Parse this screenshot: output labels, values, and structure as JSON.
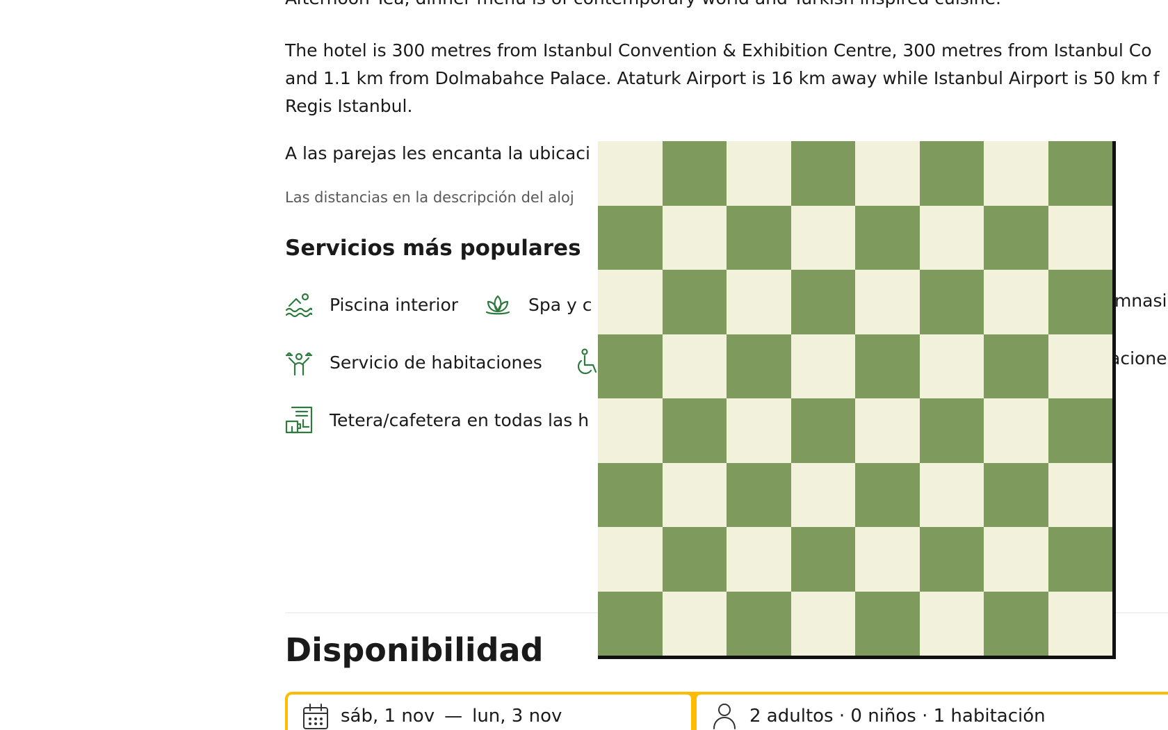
{
  "description": {
    "top_line": "Afternoon Tea, dinner menu is of contemporary world and Turkish inspired cuisine.",
    "hotel_lines": [
      "The hotel is 300 metres from Istanbul Convention & Exhibition Centre, 300 metres from Istanbul Co",
      "and 1.1 km from Dolmabahce Palace. Ataturk Airport is 16 km away while Istanbul Airport is 50 km f",
      "Regis Istanbul."
    ],
    "couples": "A las parejas les encanta la ubicaci",
    "distance_note": "Las distancias en la descripción del aloj"
  },
  "popular_facilities": {
    "title": "Servicios más populares",
    "items": [
      {
        "icon": "swimming-pool-icon",
        "label": "Piscina interior"
      },
      {
        "icon": "spa-lotus-icon",
        "label": "Spa y c"
      },
      {
        "icon": "",
        "label": "imnasi"
      },
      {
        "icon": "room-service-icon",
        "label": "Servicio de habitaciones"
      },
      {
        "icon": "wheelchair-icon",
        "label": ""
      },
      {
        "icon": "",
        "label": "acione"
      },
      {
        "icon": "kettle-icon",
        "label": "Tetera/cafetera en todas las h"
      }
    ]
  },
  "availability": {
    "title": "Disponibilidad",
    "check_in": "sáb, 1 nov",
    "separator": "—",
    "check_out": "lun, 3 nov",
    "guests": "2 adultos · 0 niños · 1 habitación"
  },
  "colors": {
    "accent_green": "#2d7a3e",
    "search_border": "#febb02",
    "board_light": "#f2f2dc",
    "board_dark": "#7e9a5d"
  },
  "chessboard": {
    "rows": 8,
    "cols": 8
  }
}
